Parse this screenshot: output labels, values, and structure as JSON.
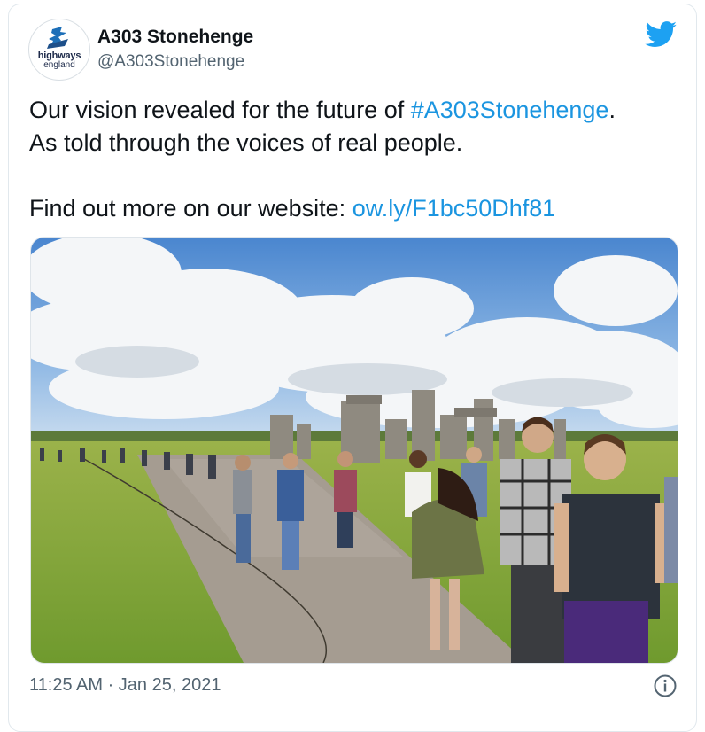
{
  "account": {
    "name": "A303 Stonehenge",
    "handle": "@A303Stonehenge",
    "avatar_text_1": "highways",
    "avatar_text_2": "england"
  },
  "tweet": {
    "line1_text": "Our vision revealed for the future of ",
    "line1_hashtag": "#A303Stonehenge",
    "line1_end": ".",
    "line2": "As told through the voices of real people.",
    "line3_text": "Find out more on our website: ",
    "line3_link": "ow.ly/F1bc50Dhf81"
  },
  "meta": {
    "timestamp": "11:25 AM · Jan 25, 2021"
  },
  "icons": {
    "brand": "twitter-bird-icon",
    "info": "info-icon",
    "avatar_logo": "highways-england-logo"
  },
  "colors": {
    "link": "#1b95e0",
    "text": "#0f1419",
    "secondary": "#536471",
    "twitter_blue": "#1da1f2"
  }
}
